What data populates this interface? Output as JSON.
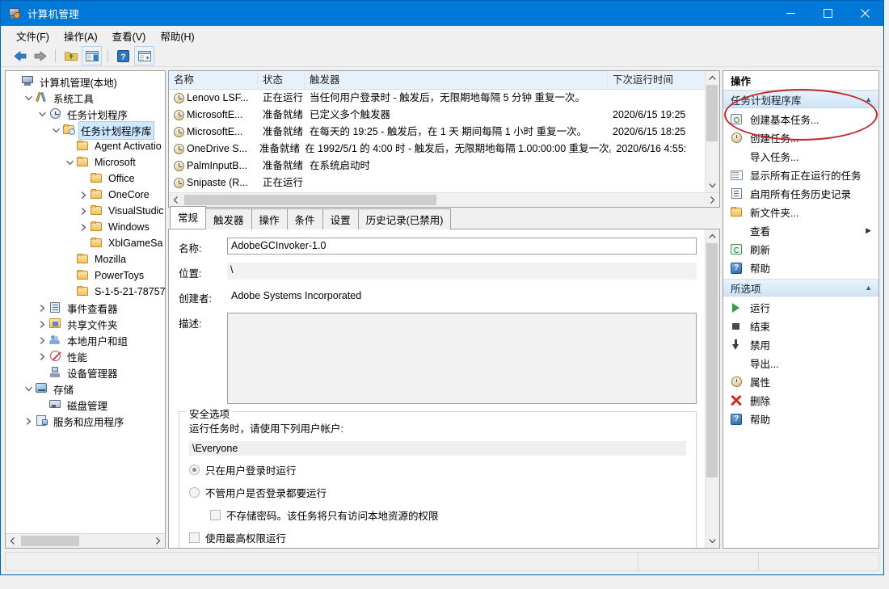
{
  "window": {
    "title": "计算机管理",
    "icon": "computer-management-icon",
    "controls": {
      "minimize": "最小化",
      "maximize": "最大化",
      "close": "关闭"
    }
  },
  "menubar": [
    {
      "label": "文件(F)",
      "name": "menu-file"
    },
    {
      "label": "操作(A)",
      "name": "menu-action"
    },
    {
      "label": "查看(V)",
      "name": "menu-view"
    },
    {
      "label": "帮助(H)",
      "name": "menu-help"
    }
  ],
  "toolbar": [
    {
      "name": "back-button",
      "icon": "arrow-left-icon"
    },
    {
      "name": "forward-button",
      "icon": "arrow-right-icon"
    },
    {
      "name": "up-folder-button",
      "icon": "folder-up-icon"
    },
    {
      "name": "show-hide-tree-button",
      "icon": "show-tree-icon"
    },
    {
      "name": "help-button",
      "icon": "help-icon"
    },
    {
      "name": "show-action-pane-button",
      "icon": "action-pane-icon"
    }
  ],
  "tree": {
    "items": [
      {
        "label": "计算机管理(本地)",
        "indent": 0,
        "twisty": "none",
        "icon": "computer-icon",
        "selected": false
      },
      {
        "label": "系统工具",
        "indent": 1,
        "twisty": "expanded",
        "icon": "tools-icon",
        "selected": false
      },
      {
        "label": "任务计划程序",
        "indent": 2,
        "twisty": "expanded",
        "icon": "clock-icon",
        "selected": false
      },
      {
        "label": "任务计划程序库",
        "indent": 3,
        "twisty": "expanded",
        "icon": "library-folder-icon",
        "selected": true
      },
      {
        "label": "Agent Activatio",
        "indent": 4,
        "twisty": "none",
        "icon": "folder-icon",
        "selected": false
      },
      {
        "label": "Microsoft",
        "indent": 4,
        "twisty": "expanded",
        "icon": "folder-icon",
        "selected": false
      },
      {
        "label": "Office",
        "indent": 5,
        "twisty": "none",
        "icon": "folder-icon",
        "selected": false
      },
      {
        "label": "OneCore",
        "indent": 5,
        "twisty": "collapsed",
        "icon": "folder-icon",
        "selected": false
      },
      {
        "label": "VisualStudic",
        "indent": 5,
        "twisty": "collapsed",
        "icon": "folder-icon",
        "selected": false
      },
      {
        "label": "Windows",
        "indent": 5,
        "twisty": "collapsed",
        "icon": "folder-icon",
        "selected": false
      },
      {
        "label": "XblGameSa",
        "indent": 5,
        "twisty": "none",
        "icon": "folder-icon",
        "selected": false
      },
      {
        "label": "Mozilla",
        "indent": 4,
        "twisty": "none",
        "icon": "folder-icon",
        "selected": false
      },
      {
        "label": "PowerToys",
        "indent": 4,
        "twisty": "none",
        "icon": "folder-icon",
        "selected": false
      },
      {
        "label": "S-1-5-21-78757",
        "indent": 4,
        "twisty": "none",
        "icon": "folder-icon",
        "selected": false
      },
      {
        "label": "事件查看器",
        "indent": 2,
        "twisty": "collapsed",
        "icon": "event-viewer-icon",
        "selected": false
      },
      {
        "label": "共享文件夹",
        "indent": 2,
        "twisty": "collapsed",
        "icon": "shared-folders-icon",
        "selected": false
      },
      {
        "label": "本地用户和组",
        "indent": 2,
        "twisty": "collapsed",
        "icon": "local-users-icon",
        "selected": false
      },
      {
        "label": "性能",
        "indent": 2,
        "twisty": "collapsed",
        "icon": "performance-icon",
        "selected": false
      },
      {
        "label": "设备管理器",
        "indent": 2,
        "twisty": "none",
        "icon": "device-manager-icon",
        "selected": false
      },
      {
        "label": "存储",
        "indent": 1,
        "twisty": "expanded",
        "icon": "storage-icon",
        "selected": false
      },
      {
        "label": "磁盘管理",
        "indent": 2,
        "twisty": "none",
        "icon": "disk-management-icon",
        "selected": false
      },
      {
        "label": "服务和应用程序",
        "indent": 1,
        "twisty": "collapsed",
        "icon": "services-icon",
        "selected": false
      }
    ]
  },
  "tasklist": {
    "columns": {
      "name": "名称",
      "status": "状态",
      "triggers": "触发器",
      "next_run": "下次运行时间"
    },
    "rows": [
      {
        "name": "Lenovo LSF...",
        "status": "正在运行",
        "trigger": "当任何用户登录时 - 触发后，无限期地每隔 5 分钟 重复一次。",
        "next_run": ""
      },
      {
        "name": "MicrosoftE...",
        "status": "准备就绪",
        "trigger": "已定义多个触发器",
        "next_run": "2020/6/15 19:25"
      },
      {
        "name": "MicrosoftE...",
        "status": "准备就绪",
        "trigger": "在每天的 19:25 - 触发后，在 1 天 期间每隔 1 小时 重复一次。",
        "next_run": "2020/6/15 18:25"
      },
      {
        "name": "OneDrive S...",
        "status": "准备就绪",
        "trigger": "在 1992/5/1 的 4:00 时 - 触发后，无限期地每隔 1.00:00:00 重复一次。",
        "next_run": "2020/6/16 4:55:"
      },
      {
        "name": "PalmInputB...",
        "status": "准备就绪",
        "trigger": "在系统启动时",
        "next_run": ""
      },
      {
        "name": "Snipaste (R...",
        "status": "正在运行",
        "trigger": "",
        "next_run": ""
      }
    ]
  },
  "details": {
    "tabs": [
      {
        "label": "常规",
        "active": true
      },
      {
        "label": "触发器",
        "active": false
      },
      {
        "label": "操作",
        "active": false
      },
      {
        "label": "条件",
        "active": false
      },
      {
        "label": "设置",
        "active": false
      },
      {
        "label": "历史记录(已禁用)",
        "active": false
      }
    ],
    "fields": {
      "name_label": "名称:",
      "name_value": "AdobeGCInvoker-1.0",
      "location_label": "位置:",
      "location_value": "\\",
      "author_label": "创建者:",
      "author_value": "Adobe Systems Incorporated",
      "description_label": "描述:",
      "description_value": ""
    },
    "security": {
      "group_title": "安全选项",
      "prompt": "运行任务时，请使用下列用户帐户:",
      "account": "\\Everyone",
      "radio_logged_on": "只在用户登录时运行",
      "radio_whether_or_not": "不管用户是否登录都要运行",
      "check_no_store_password": "不存储密码。该任务将只有访问本地资源的权限",
      "check_highest_privileges": "使用最高权限运行"
    }
  },
  "actions": {
    "title": "操作",
    "sections": [
      {
        "header": "任务计划程序库",
        "name": "section-task-scheduler-library",
        "items": [
          {
            "label": "创建基本任务...",
            "icon": "create-basic-task-icon",
            "submenu": false
          },
          {
            "label": "创建任务...",
            "icon": "create-task-icon",
            "submenu": false
          },
          {
            "label": "导入任务...",
            "icon": "none",
            "submenu": false
          },
          {
            "label": "显示所有正在运行的任务",
            "icon": "show-running-tasks-icon",
            "submenu": false
          },
          {
            "label": "启用所有任务历史记录",
            "icon": "task-history-icon",
            "submenu": false
          },
          {
            "label": "新文件夹...",
            "icon": "new-folder-icon",
            "submenu": false
          },
          {
            "label": "查看",
            "icon": "none",
            "submenu": true
          },
          {
            "label": "刷新",
            "icon": "refresh-icon",
            "submenu": false
          },
          {
            "label": "帮助",
            "icon": "help-icon",
            "submenu": false
          }
        ]
      },
      {
        "header": "所选项",
        "name": "section-selected-item",
        "items": [
          {
            "label": "运行",
            "icon": "run-icon",
            "submenu": false
          },
          {
            "label": "结束",
            "icon": "end-icon",
            "submenu": false
          },
          {
            "label": "禁用",
            "icon": "disable-icon",
            "submenu": false
          },
          {
            "label": "导出...",
            "icon": "none",
            "submenu": false
          },
          {
            "label": "属性",
            "icon": "properties-icon",
            "submenu": false
          },
          {
            "label": "删除",
            "icon": "delete-icon",
            "submenu": false
          },
          {
            "label": "帮助",
            "icon": "help-icon",
            "submenu": false
          }
        ]
      }
    ]
  },
  "annotation": {
    "shape": "red-ellipse",
    "color": "#c0282d",
    "targets": "任务计划程序库 / 创建基本任务..."
  },
  "statusbar": {
    "text": ""
  },
  "colors": {
    "titlebar": "#0078d7",
    "selection": "#cde8ff",
    "section_header": "#cfe4f7",
    "annotation": "#c0282d"
  }
}
